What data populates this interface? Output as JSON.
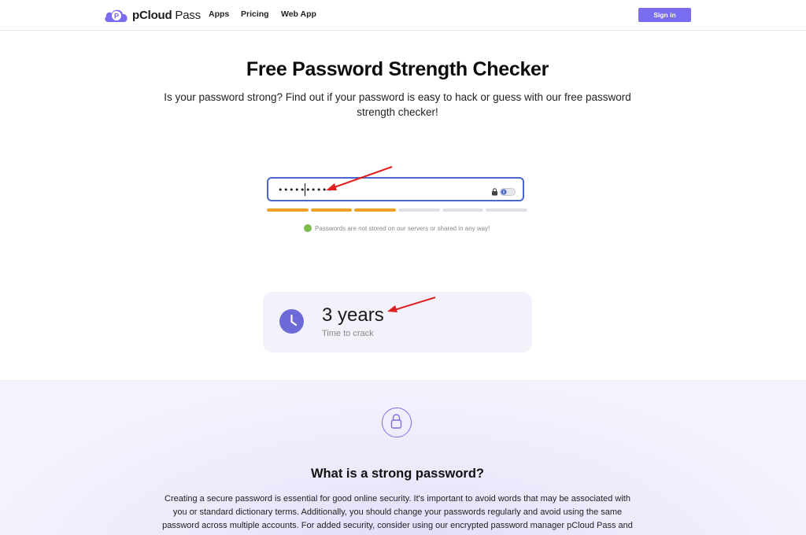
{
  "header": {
    "logo_text_bold": "pCloud",
    "logo_text_light": " Pass",
    "nav": [
      "Apps",
      "Pricing",
      "Web App"
    ],
    "signin_label": "Sign in"
  },
  "hero": {
    "title": "Free Password Strength Checker",
    "subtitle": "Is your password strong? Find out if your password is easy to hack or guess with our free password strength checker!"
  },
  "password_field": {
    "value": "••••••••••",
    "strength_segments_filled": 3,
    "strength_segments_total": 6
  },
  "privacy_note": "Passwords are not stored on our servers or shared in any way!",
  "result": {
    "value": "3 years",
    "label": "Time to crack"
  },
  "info": {
    "title": "What is a strong password?",
    "text": "Creating a secure password is essential for good online security. It's important to avoid words that may be associated with you or standard dictionary terms. Additionally, you should change your passwords regularly and avoid using the same password across multiple accounts. For added security, consider using our encrypted password manager pCloud Pass and"
  },
  "colors": {
    "accent": "#7a6cf0",
    "strength_filled": "#f0a023",
    "strength_empty": "#dfe0ea",
    "annotation_arrow": "#e02020"
  },
  "icons": [
    "pcloud-logo-icon",
    "lock-icon",
    "toggle-visibility-icon",
    "check-shield-icon",
    "clock-icon",
    "padlock-icon"
  ]
}
